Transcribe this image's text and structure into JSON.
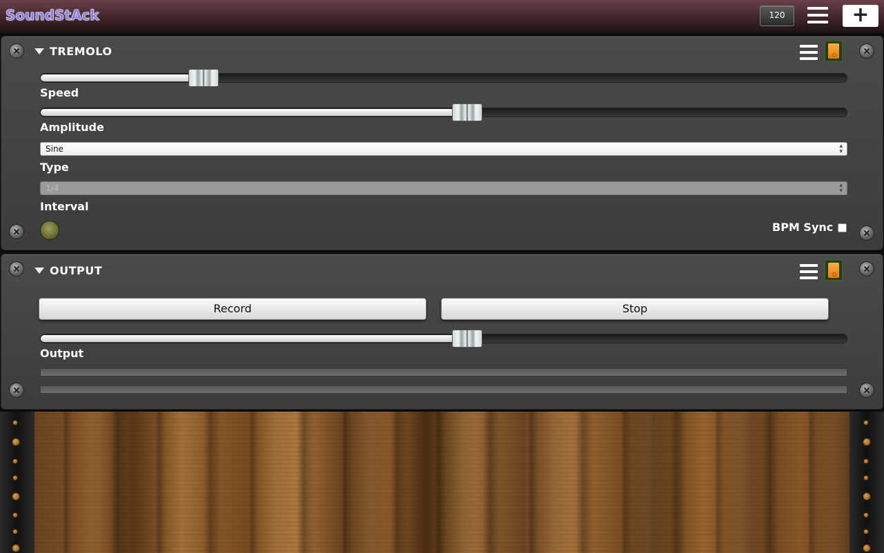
{
  "app": {
    "logo_text": "SoundStAck",
    "bpm": "120"
  },
  "tremolo": {
    "title": "TREMOLO",
    "speed": {
      "label": "Speed",
      "value_fraction": 0.19
    },
    "amplitude": {
      "label": "Amplitude",
      "value_fraction": 0.53
    },
    "type": {
      "label": "Type",
      "selected": "Sine"
    },
    "interval": {
      "label": "Interval",
      "selected": "1/4",
      "disabled": true
    },
    "bpm_sync": {
      "label": "BPM Sync",
      "checked": false
    }
  },
  "output": {
    "title": "OUTPUT",
    "record_label": "Record",
    "stop_label": "Stop",
    "output_slider": {
      "label": "Output",
      "value_fraction": 0.53
    }
  },
  "colors": {
    "topbar": "#4a2c32",
    "panel": "#444444",
    "power_on": "#f0a030",
    "logo": "#8a7ae0"
  },
  "icons": {
    "menu": "hamburger-icon",
    "add": "plus-icon",
    "collapse": "caret-down-icon",
    "power": "power-switch-icon",
    "screw": "screw-icon"
  }
}
